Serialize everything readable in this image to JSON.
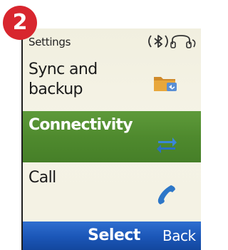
{
  "step": {
    "number": "2",
    "color": "#d8262e"
  },
  "status_bar": {
    "title": "Settings",
    "icons": [
      "bluetooth-icon",
      "headset-icon"
    ]
  },
  "menu": {
    "items": [
      {
        "label_line1": "Sync and",
        "label_line2": "backup",
        "icon": "folder-sync-icon",
        "selected": false
      },
      {
        "label": "Connectivity",
        "icon": "connectivity-arrows-icon",
        "selected": true
      },
      {
        "label": "Call",
        "icon": "phone-handset-icon",
        "selected": false
      }
    ]
  },
  "softkeys": {
    "left": "",
    "middle": "Select",
    "right": "Back"
  },
  "colors": {
    "selection": "#4f8a2e",
    "softkey_bar": "#1b56b7",
    "screen_bg": "#f3f1e3"
  }
}
